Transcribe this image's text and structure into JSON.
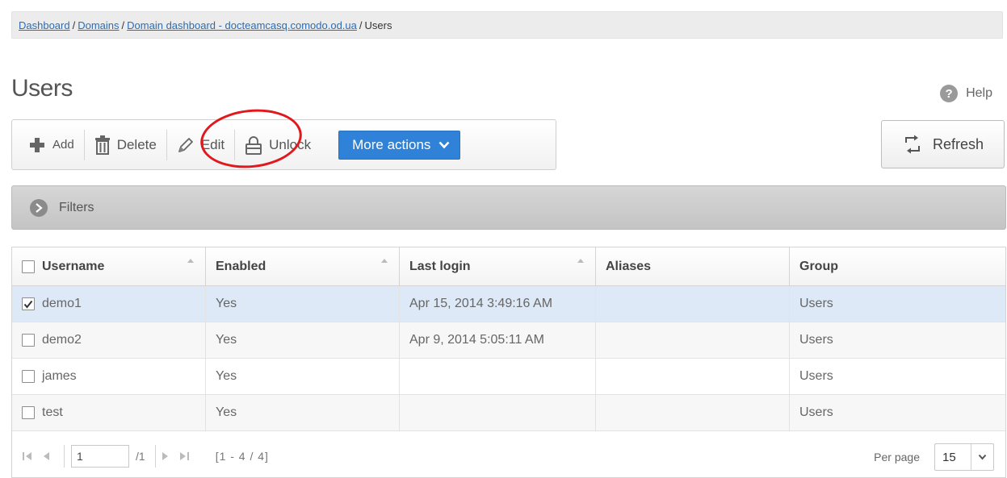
{
  "breadcrumb": {
    "items": [
      {
        "label": "Dashboard",
        "link": true
      },
      {
        "label": "Domains",
        "link": true
      },
      {
        "label": "Domain dashboard - docteamcasq.comodo.od.ua",
        "link": true
      },
      {
        "label": "Users",
        "link": false
      }
    ],
    "separator": "/"
  },
  "page": {
    "title": "Users",
    "help_label": "Help",
    "help_icon": "?"
  },
  "toolbar": {
    "add_label": "Add",
    "delete_label": "Delete",
    "edit_label": "Edit",
    "unlock_label": "Unlock",
    "more_actions_label": "More actions"
  },
  "refresh_label": "Refresh",
  "filters_label": "Filters",
  "table": {
    "columns": [
      "Username",
      "Enabled",
      "Last login",
      "Aliases",
      "Group"
    ],
    "rows": [
      {
        "checked": true,
        "username": "demo1",
        "enabled": "Yes",
        "last_login": "Apr 15, 2014 3:49:16 AM",
        "aliases": "",
        "group": "Users"
      },
      {
        "checked": false,
        "username": "demo2",
        "enabled": "Yes",
        "last_login": "Apr 9, 2014 5:05:11 AM",
        "aliases": "",
        "group": "Users"
      },
      {
        "checked": false,
        "username": "james",
        "enabled": "Yes",
        "last_login": "",
        "aliases": "",
        "group": "Users"
      },
      {
        "checked": false,
        "username": "test",
        "enabled": "Yes",
        "last_login": "",
        "aliases": "",
        "group": "Users"
      }
    ]
  },
  "pager": {
    "page_value": "1",
    "total_pages": "/1",
    "range": "[1 - 4 / 4]",
    "per_page_label": "Per page",
    "per_page_value": "15"
  },
  "colors": {
    "accent": "#2f82d8",
    "selected_row": "#dde9f7",
    "highlight_circle": "#e0191f",
    "link": "#2a6db5"
  }
}
